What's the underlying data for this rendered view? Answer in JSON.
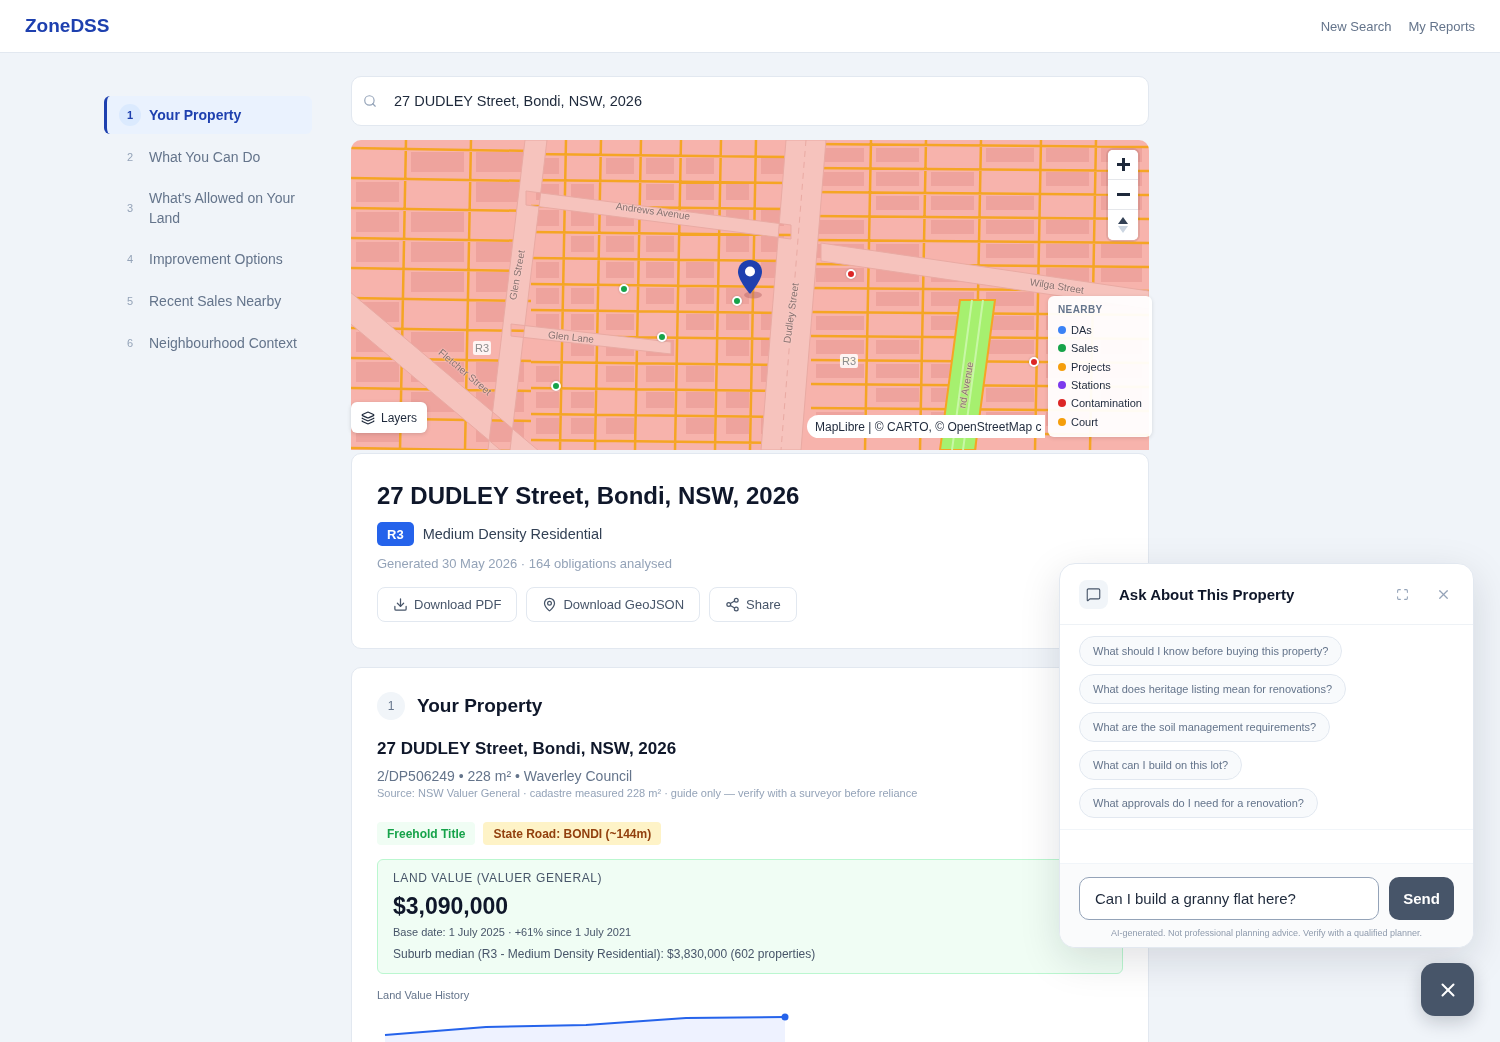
{
  "header": {
    "logo": "ZoneDSS",
    "nav": [
      "New Search",
      "My Reports"
    ]
  },
  "sidebar": {
    "items": [
      {
        "number": "1",
        "label": "Your Property",
        "selected": true
      },
      {
        "number": "2",
        "label": "What You Can Do",
        "selected": false
      },
      {
        "number": "3",
        "label": "What's Allowed on Your Land",
        "selected": false
      },
      {
        "number": "4",
        "label": "Improvement Options",
        "selected": false
      },
      {
        "number": "5",
        "label": "Recent Sales Nearby",
        "selected": false
      },
      {
        "number": "6",
        "label": "Neighbourhood Context",
        "selected": false
      }
    ]
  },
  "search": {
    "value": "27 DUDLEY Street, Bondi, NSW, 2026"
  },
  "map": {
    "labels": [
      {
        "kind": "street",
        "text": "Andrews Avenue"
      },
      {
        "kind": "street",
        "text": "Glen Street"
      },
      {
        "kind": "street",
        "text": "Glen Lane"
      },
      {
        "kind": "zone",
        "text": "R3"
      },
      {
        "kind": "street",
        "text": "Fletcher Street"
      },
      {
        "kind": "street",
        "text": "Dudley Street"
      },
      {
        "kind": "street",
        "text": "Wilga Street"
      },
      {
        "kind": "zone",
        "text": "R3"
      },
      {
        "kind": "street",
        "text": "nd Avenue"
      }
    ],
    "markers": [
      {
        "color": "#dc2626"
      },
      {
        "color": "#16a34a"
      },
      {
        "color": "#16a34a"
      },
      {
        "color": "#16a34a"
      },
      {
        "color": "#dc2626"
      },
      {
        "color": "#16a34a"
      }
    ],
    "layers_button": "Layers",
    "attribution": "MapLibre | © CARTO, © OpenStreetMap c",
    "legend": {
      "title": "NEARBY",
      "items": [
        {
          "label": "DAs",
          "color": "#3b82f6"
        },
        {
          "label": "Sales",
          "color": "#16a34a"
        },
        {
          "label": "Projects",
          "color": "#f59e0b"
        },
        {
          "label": "Stations",
          "color": "#7c3aed"
        },
        {
          "label": "Contamination",
          "color": "#dc2626"
        },
        {
          "label": "Court",
          "color": "#f59e0b"
        }
      ]
    }
  },
  "property": {
    "title": "27 DUDLEY Street, Bondi, NSW, 2026",
    "zone_code": "R3",
    "zone_name": "Medium Density Residential",
    "meta": "Generated 30 May 2026 · 164 obligations analysed",
    "actions": [
      {
        "kind": "download",
        "label": "Download PDF"
      },
      {
        "kind": "pin",
        "label": "Download GeoJSON"
      },
      {
        "kind": "share",
        "label": "Share"
      }
    ]
  },
  "section": {
    "number": "1",
    "title": "Your Property",
    "address": "27 DUDLEY Street, Bondi, NSW, 2026",
    "details": "2/DP506249 • 228 m² • Waverley Council",
    "source": "Source: NSW Valuer General · cadastre measured 228 m² · guide only — verify with a surveyor before reliance",
    "tags": [
      {
        "kind": "success",
        "label": "Freehold Title"
      },
      {
        "kind": "warning",
        "label": "State Road: BONDI (~144m)"
      }
    ],
    "land_value": {
      "label": "LAND VALUE (VALUER GENERAL)",
      "value": "$3,090,000",
      "base_date": "Base date: 1 July 2025 · +61% since 1 July 2021",
      "suburb_median": "Suburb median (R3 - Medium Density Residential): $3,830,000 (602 properties)"
    },
    "history_title": "Land Value History"
  },
  "chat": {
    "title": "Ask About This Property",
    "suggestions": [
      "What should I know before buying this property?",
      "What does heritage listing mean for renovations?",
      "What are the soil management requirements?",
      "What can I build on this lot?",
      "What approvals do I need for a renovation?"
    ],
    "input": {
      "value": "Can I build a granny flat here?"
    },
    "send": "Send",
    "disclaimer": "AI-generated. Not professional planning advice. Verify with a qualified planner."
  }
}
